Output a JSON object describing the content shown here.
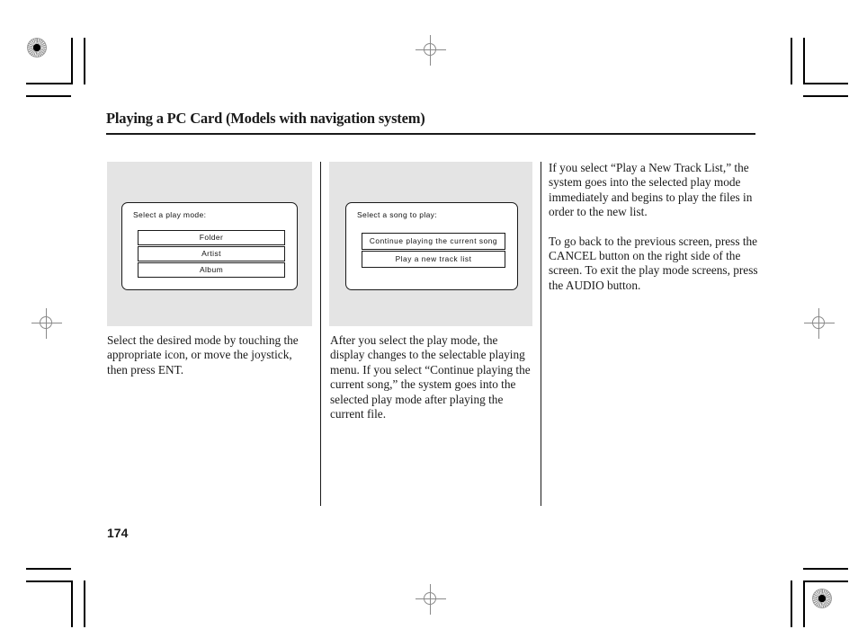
{
  "page": {
    "title": "Playing a PC Card (Models with navigation system)",
    "number": "174"
  },
  "figures": [
    {
      "id": "figure-play-mode",
      "screen_label": "Select a play mode:",
      "buttons": [
        "Folder",
        "Artist",
        "Album"
      ]
    },
    {
      "id": "figure-song-select",
      "screen_label": "Select a song to play:",
      "buttons": [
        "Continue playing the  current  song",
        "Play a  new  track  list"
      ]
    }
  ],
  "columns": {
    "left": [
      "Select the desired mode by touching the appropriate icon, or move the joystick, then press ENT."
    ],
    "middle": [
      "After you select the play mode, the display changes to the selectable playing menu. If you select “Continue playing the current song,” the system goes into the selected play mode after playing the current file."
    ],
    "right": [
      "If you select “Play a New Track List,” the system goes into the selected play mode immediately and begins to play the files in order to the new list.",
      "To go back to the previous screen, press the CANCEL button on the right side of the screen. To exit the play mode screens, press the AUDIO button."
    ]
  },
  "colors": {
    "text": "#1a1a1a",
    "figure_background": "#e4e4e4",
    "screen_background": "#ffffff",
    "rule": "#1a1a1a"
  }
}
